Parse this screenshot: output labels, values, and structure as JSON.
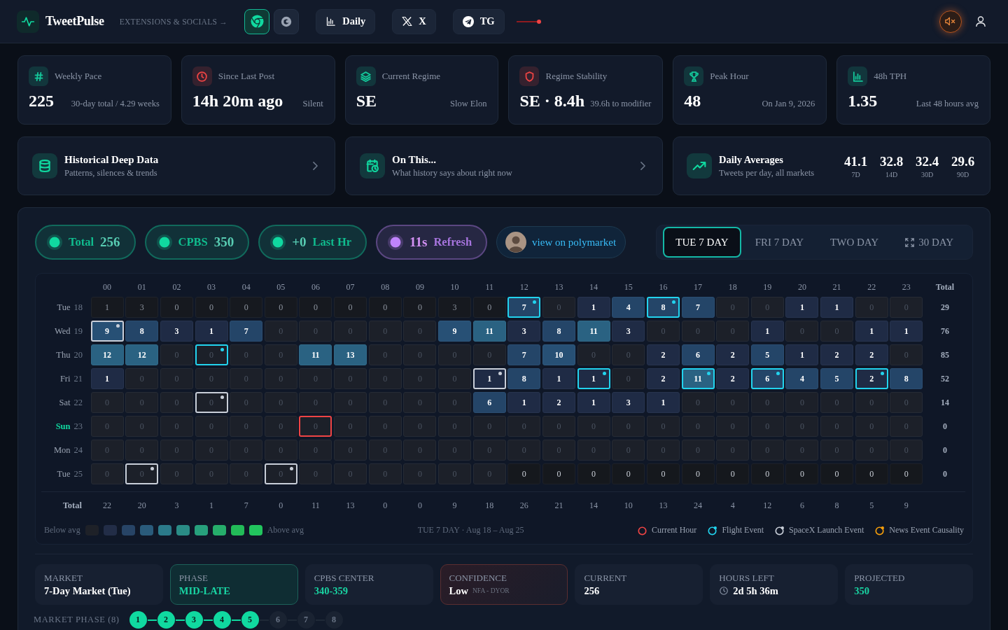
{
  "header": {
    "brand": "TweetPulse",
    "tagline": "EXTENSIONS & SOCIALS →",
    "extensions": [
      {
        "selected": true
      },
      {
        "selected": false
      }
    ],
    "links": [
      {
        "label": "Daily"
      },
      {
        "label": "X"
      },
      {
        "label": "TG"
      }
    ],
    "sound_muted": true
  },
  "stats": [
    {
      "label": "Weekly Pace",
      "value": "225",
      "note": "30-day total / 4.29 weeks",
      "color": "#14c99b"
    },
    {
      "label": "Since Last Post",
      "value": "14h 20m ago",
      "note": "Silent",
      "color": "#ef4444"
    },
    {
      "label": "Current Regime",
      "value": "SE",
      "note": "Slow Elon",
      "color": "#14c99b"
    },
    {
      "label": "Regime Stability",
      "value": "SE · 8.4h",
      "note": "39.6h to modifier",
      "color": "#ef4444"
    },
    {
      "label": "Peak Hour",
      "value": "48",
      "note": "On Jan 9, 2026",
      "color": "#14c99b"
    },
    {
      "label": "48h TPH",
      "value": "1.35",
      "note": "Last 48 hours avg",
      "color": "#14c99b"
    }
  ],
  "shortcuts": [
    {
      "title": "Historical Deep Data",
      "subtitle": "Patterns, silences & trends"
    },
    {
      "title": "On This...",
      "subtitle": "What history says about right now"
    }
  ],
  "daily_averages": {
    "title": "Daily Averages",
    "subtitle": "Tweets per day, all markets",
    "values": [
      {
        "value": "41.1",
        "period": "7D"
      },
      {
        "value": "32.8",
        "period": "14D"
      },
      {
        "value": "32.4",
        "period": "30D"
      },
      {
        "value": "29.6",
        "period": "90D"
      }
    ]
  },
  "panel": {
    "pills": [
      {
        "label": "Total",
        "value": "256",
        "kind": "label-first",
        "color": "#10d9a0"
      },
      {
        "label": "CPBS",
        "value": "350",
        "kind": "label-first",
        "color": "#10d9a0"
      },
      {
        "label": "Last Hr",
        "value": "+0",
        "kind": "value-first",
        "color": "#10d9a0"
      },
      {
        "label": "Refresh",
        "value": "11s",
        "kind": "value-first",
        "color": "#c084fc"
      }
    ],
    "polymarket": {
      "label": "view on polymarket"
    },
    "tabs": [
      {
        "label": "TUE 7 DAY",
        "selected": true
      },
      {
        "label": "FRI 7 DAY",
        "selected": false
      },
      {
        "label": "TWO DAY",
        "selected": false
      },
      {
        "label": "30 DAY",
        "selected": false
      }
    ],
    "grid": {
      "hours": [
        "00",
        "01",
        "02",
        "03",
        "04",
        "05",
        "06",
        "07",
        "08",
        "09",
        "10",
        "11",
        "12",
        "13",
        "14",
        "15",
        "16",
        "17",
        "18",
        "19",
        "20",
        "21",
        "22",
        "23"
      ],
      "total_label": "Total",
      "rows": [
        {
          "day": "Tue",
          "date": "18",
          "today": false,
          "total": "29",
          "cells": [
            {
              "value": "1",
              "kind": "pre"
            },
            {
              "value": "3",
              "kind": "pre"
            },
            {
              "value": "0",
              "kind": "pre"
            },
            {
              "value": "0",
              "kind": "pre"
            },
            {
              "value": "0",
              "kind": "pre"
            },
            {
              "value": "0",
              "kind": "pre"
            },
            {
              "value": "0",
              "kind": "pre"
            },
            {
              "value": "0",
              "kind": "pre"
            },
            {
              "value": "0",
              "kind": "pre"
            },
            {
              "value": "0",
              "kind": "pre"
            },
            {
              "value": "3",
              "kind": "pre"
            },
            {
              "value": "0",
              "kind": "pre"
            },
            {
              "value": "7",
              "kind": "flight"
            },
            {
              "value": "0",
              "kind": "live"
            },
            {
              "value": "1",
              "kind": "live"
            },
            {
              "value": "4",
              "kind": "live"
            },
            {
              "value": "8",
              "kind": "flight"
            },
            {
              "value": "7",
              "kind": "live"
            },
            {
              "value": "0",
              "kind": "live"
            },
            {
              "value": "0",
              "kind": "live"
            },
            {
              "value": "1",
              "kind": "live"
            },
            {
              "value": "1",
              "kind": "live"
            },
            {
              "value": "0",
              "kind": "live"
            },
            {
              "value": "0",
              "kind": "live"
            }
          ]
        },
        {
          "day": "Wed",
          "date": "19",
          "today": false,
          "total": "76",
          "cells": [
            {
              "value": "9",
              "kind": "spacex"
            },
            {
              "value": "8",
              "kind": "live"
            },
            {
              "value": "3",
              "kind": "live"
            },
            {
              "value": "1",
              "kind": "live"
            },
            {
              "value": "7",
              "kind": "live"
            },
            {
              "value": "0",
              "kind": "live"
            },
            {
              "value": "0",
              "kind": "live"
            },
            {
              "value": "0",
              "kind": "live"
            },
            {
              "value": "0",
              "kind": "live"
            },
            {
              "value": "0",
              "kind": "live"
            },
            {
              "value": "9",
              "kind": "live"
            },
            {
              "value": "11",
              "kind": "live"
            },
            {
              "value": "3",
              "kind": "live"
            },
            {
              "value": "8",
              "kind": "live"
            },
            {
              "value": "11",
              "kind": "live"
            },
            {
              "value": "3",
              "kind": "live"
            },
            {
              "value": "0",
              "kind": "live"
            },
            {
              "value": "0",
              "kind": "live"
            },
            {
              "value": "0",
              "kind": "live"
            },
            {
              "value": "1",
              "kind": "live"
            },
            {
              "value": "0",
              "kind": "live"
            },
            {
              "value": "0",
              "kind": "live"
            },
            {
              "value": "1",
              "kind": "live"
            },
            {
              "value": "1",
              "kind": "live"
            }
          ]
        },
        {
          "day": "Thu",
          "date": "20",
          "today": false,
          "total": "85",
          "cells": [
            {
              "value": "12",
              "kind": "live"
            },
            {
              "value": "12",
              "kind": "live"
            },
            {
              "value": "0",
              "kind": "live"
            },
            {
              "value": "0",
              "kind": "flight"
            },
            {
              "value": "0",
              "kind": "live"
            },
            {
              "value": "0",
              "kind": "live"
            },
            {
              "value": "11",
              "kind": "live"
            },
            {
              "value": "13",
              "kind": "live"
            },
            {
              "value": "0",
              "kind": "live"
            },
            {
              "value": "0",
              "kind": "live"
            },
            {
              "value": "0",
              "kind": "live"
            },
            {
              "value": "0",
              "kind": "live"
            },
            {
              "value": "7",
              "kind": "live"
            },
            {
              "value": "10",
              "kind": "live"
            },
            {
              "value": "0",
              "kind": "live"
            },
            {
              "value": "0",
              "kind": "live"
            },
            {
              "value": "2",
              "kind": "live"
            },
            {
              "value": "6",
              "kind": "live"
            },
            {
              "value": "2",
              "kind": "live"
            },
            {
              "value": "5",
              "kind": "live"
            },
            {
              "value": "1",
              "kind": "live"
            },
            {
              "value": "2",
              "kind": "live"
            },
            {
              "value": "2",
              "kind": "live"
            },
            {
              "value": "0",
              "kind": "live"
            }
          ]
        },
        {
          "day": "Fri",
          "date": "21",
          "today": false,
          "total": "52",
          "cells": [
            {
              "value": "1",
              "kind": "live"
            },
            {
              "value": "0",
              "kind": "live"
            },
            {
              "value": "0",
              "kind": "live"
            },
            {
              "value": "0",
              "kind": "live"
            },
            {
              "value": "0",
              "kind": "live"
            },
            {
              "value": "0",
              "kind": "live"
            },
            {
              "value": "0",
              "kind": "live"
            },
            {
              "value": "0",
              "kind": "live"
            },
            {
              "value": "0",
              "kind": "live"
            },
            {
              "value": "0",
              "kind": "live"
            },
            {
              "value": "0",
              "kind": "live"
            },
            {
              "value": "1",
              "kind": "spacex"
            },
            {
              "value": "8",
              "kind": "live"
            },
            {
              "value": "1",
              "kind": "live"
            },
            {
              "value": "1",
              "kind": "flight"
            },
            {
              "value": "0",
              "kind": "live"
            },
            {
              "value": "2",
              "kind": "live"
            },
            {
              "value": "11",
              "kind": "flight"
            },
            {
              "value": "2",
              "kind": "live"
            },
            {
              "value": "6",
              "kind": "flight"
            },
            {
              "value": "4",
              "kind": "live"
            },
            {
              "value": "5",
              "kind": "live"
            },
            {
              "value": "2",
              "kind": "flight"
            },
            {
              "value": "8",
              "kind": "live"
            }
          ]
        },
        {
          "day": "Sat",
          "date": "22",
          "today": false,
          "total": "14",
          "cells": [
            {
              "value": "0",
              "kind": "live"
            },
            {
              "value": "0",
              "kind": "live"
            },
            {
              "value": "0",
              "kind": "live"
            },
            {
              "value": "0",
              "kind": "spacex"
            },
            {
              "value": "0",
              "kind": "live"
            },
            {
              "value": "0",
              "kind": "live"
            },
            {
              "value": "0",
              "kind": "live"
            },
            {
              "value": "0",
              "kind": "live"
            },
            {
              "value": "0",
              "kind": "live"
            },
            {
              "value": "0",
              "kind": "live"
            },
            {
              "value": "0",
              "kind": "live"
            },
            {
              "value": "6",
              "kind": "live"
            },
            {
              "value": "1",
              "kind": "live"
            },
            {
              "value": "2",
              "kind": "live"
            },
            {
              "value": "1",
              "kind": "live"
            },
            {
              "value": "3",
              "kind": "live"
            },
            {
              "value": "1",
              "kind": "live"
            },
            {
              "value": "0",
              "kind": "live"
            },
            {
              "value": "0",
              "kind": "live"
            },
            {
              "value": "0",
              "kind": "live"
            },
            {
              "value": "0",
              "kind": "live"
            },
            {
              "value": "0",
              "kind": "live"
            },
            {
              "value": "0",
              "kind": "live"
            },
            {
              "value": "0",
              "kind": "live"
            }
          ]
        },
        {
          "day": "Sun",
          "date": "23",
          "today": true,
          "total": "0",
          "cells": [
            {
              "value": "0",
              "kind": "live"
            },
            {
              "value": "0",
              "kind": "live"
            },
            {
              "value": "0",
              "kind": "live"
            },
            {
              "value": "0",
              "kind": "live"
            },
            {
              "value": "0",
              "kind": "live"
            },
            {
              "value": "0",
              "kind": "live"
            },
            {
              "value": "0",
              "kind": "current"
            },
            {
              "value": "0",
              "kind": "live"
            },
            {
              "value": "0",
              "kind": "live"
            },
            {
              "value": "0",
              "kind": "live"
            },
            {
              "value": "0",
              "kind": "live"
            },
            {
              "value": "0",
              "kind": "live"
            },
            {
              "value": "0",
              "kind": "live"
            },
            {
              "value": "0",
              "kind": "live"
            },
            {
              "value": "0",
              "kind": "live"
            },
            {
              "value": "0",
              "kind": "live"
            },
            {
              "value": "0",
              "kind": "live"
            },
            {
              "value": "0",
              "kind": "live"
            },
            {
              "value": "0",
              "kind": "live"
            },
            {
              "value": "0",
              "kind": "live"
            },
            {
              "value": "0",
              "kind": "live"
            },
            {
              "value": "0",
              "kind": "live"
            },
            {
              "value": "0",
              "kind": "live"
            },
            {
              "value": "0",
              "kind": "live"
            }
          ]
        },
        {
          "day": "Mon",
          "date": "24",
          "today": false,
          "total": "0",
          "cells": [
            {
              "value": "0",
              "kind": "live"
            },
            {
              "value": "0",
              "kind": "live"
            },
            {
              "value": "0",
              "kind": "live"
            },
            {
              "value": "0",
              "kind": "live"
            },
            {
              "value": "0",
              "kind": "live"
            },
            {
              "value": "0",
              "kind": "live"
            },
            {
              "value": "0",
              "kind": "live"
            },
            {
              "value": "0",
              "kind": "live"
            },
            {
              "value": "0",
              "kind": "live"
            },
            {
              "value": "0",
              "kind": "live"
            },
            {
              "value": "0",
              "kind": "live"
            },
            {
              "value": "0",
              "kind": "live"
            },
            {
              "value": "0",
              "kind": "live"
            },
            {
              "value": "0",
              "kind": "live"
            },
            {
              "value": "0",
              "kind": "live"
            },
            {
              "value": "0",
              "kind": "live"
            },
            {
              "value": "0",
              "kind": "live"
            },
            {
              "value": "0",
              "kind": "live"
            },
            {
              "value": "0",
              "kind": "live"
            },
            {
              "value": "0",
              "kind": "live"
            },
            {
              "value": "0",
              "kind": "live"
            },
            {
              "value": "0",
              "kind": "live"
            },
            {
              "value": "0",
              "kind": "live"
            },
            {
              "value": "0",
              "kind": "live"
            }
          ]
        },
        {
          "day": "Tue",
          "date": "25",
          "today": false,
          "total": "0",
          "cells": [
            {
              "value": "0",
              "kind": "live"
            },
            {
              "value": "0",
              "kind": "spacex"
            },
            {
              "value": "0",
              "kind": "live"
            },
            {
              "value": "0",
              "kind": "live"
            },
            {
              "value": "0",
              "kind": "live"
            },
            {
              "value": "0",
              "kind": "spacex"
            },
            {
              "value": "0",
              "kind": "live"
            },
            {
              "value": "0",
              "kind": "live"
            },
            {
              "value": "0",
              "kind": "live"
            },
            {
              "value": "0",
              "kind": "live"
            },
            {
              "value": "0",
              "kind": "live"
            },
            {
              "value": "0",
              "kind": "live"
            },
            {
              "value": "0",
              "kind": "post"
            },
            {
              "value": "0",
              "kind": "post"
            },
            {
              "value": "0",
              "kind": "post"
            },
            {
              "value": "0",
              "kind": "post"
            },
            {
              "value": "0",
              "kind": "post"
            },
            {
              "value": "0",
              "kind": "post"
            },
            {
              "value": "0",
              "kind": "post"
            },
            {
              "value": "0",
              "kind": "post"
            },
            {
              "value": "0",
              "kind": "post"
            },
            {
              "value": "0",
              "kind": "post"
            },
            {
              "value": "0",
              "kind": "post"
            },
            {
              "value": "0",
              "kind": "post"
            }
          ]
        }
      ],
      "footer_label": "Total",
      "column_totals": [
        "22",
        "20",
        "3",
        "1",
        "7",
        "0",
        "11",
        "13",
        "0",
        "0",
        "9",
        "18",
        "26",
        "21",
        "14",
        "10",
        "13",
        "24",
        "4",
        "12",
        "6",
        "8",
        "5",
        "9"
      ]
    },
    "legend": {
      "low_label": "Below avg",
      "swatches": [
        {
          "color": "#1e2128"
        },
        {
          "color": "#222d47"
        },
        {
          "color": "#274466"
        },
        {
          "color": "#2a5b7b"
        },
        {
          "color": "#2b7a8a"
        },
        {
          "color": "#2a8c86"
        },
        {
          "color": "#27a07c"
        },
        {
          "color": "#26ad6b"
        },
        {
          "color": "#22bb58"
        },
        {
          "color": "#22c55e"
        }
      ],
      "high_label": "Above avg",
      "caption": "TUE 7 DAY · Aug 18 – Aug 25",
      "markers": [
        {
          "label": "Current Hour",
          "kind": "current",
          "color": "#ef4444",
          "dot": false
        },
        {
          "label": "Flight Event",
          "kind": "flight",
          "color": "#22d3ee",
          "dot": true
        },
        {
          "label": "SpaceX Launch Event",
          "kind": "spacex",
          "color": "#c8ced8",
          "dot": true
        },
        {
          "label": "News Event Causality",
          "kind": "news",
          "color": "#f59e0b",
          "dot": true
        }
      ]
    },
    "info_cards": [
      {
        "label": "MARKET",
        "value": "7-Day Market (Tue)",
        "kind": "plain",
        "accent": false
      },
      {
        "label": "PHASE",
        "value": "MID-LATE",
        "kind": "highlight",
        "accent": true
      },
      {
        "label": "CPBS CENTER",
        "value": "340-359",
        "kind": "plain",
        "accent": true
      },
      {
        "label": "CONFIDENCE",
        "value": "Low",
        "note": "NFA - DYOR",
        "kind": "alert",
        "accent": false
      },
      {
        "label": "CURRENT",
        "value": "256",
        "kind": "plain",
        "accent": false
      },
      {
        "label": "HOURS LEFT",
        "value": "2d 5h 36m",
        "kind": "plain",
        "accent": false
      },
      {
        "label": "PROJECTED",
        "value": "350",
        "kind": "plain",
        "accent": true
      }
    ],
    "phase": {
      "label": "MARKET PHASE (8)",
      "steps": [
        {
          "label": "1",
          "done": true
        },
        {
          "label": "2",
          "done": true
        },
        {
          "label": "3",
          "done": true
        },
        {
          "label": "4",
          "done": true
        },
        {
          "label": "5",
          "done": true
        },
        {
          "label": "6",
          "done": false
        },
        {
          "label": "7",
          "done": false
        },
        {
          "label": "8",
          "done": false
        }
      ]
    }
  }
}
